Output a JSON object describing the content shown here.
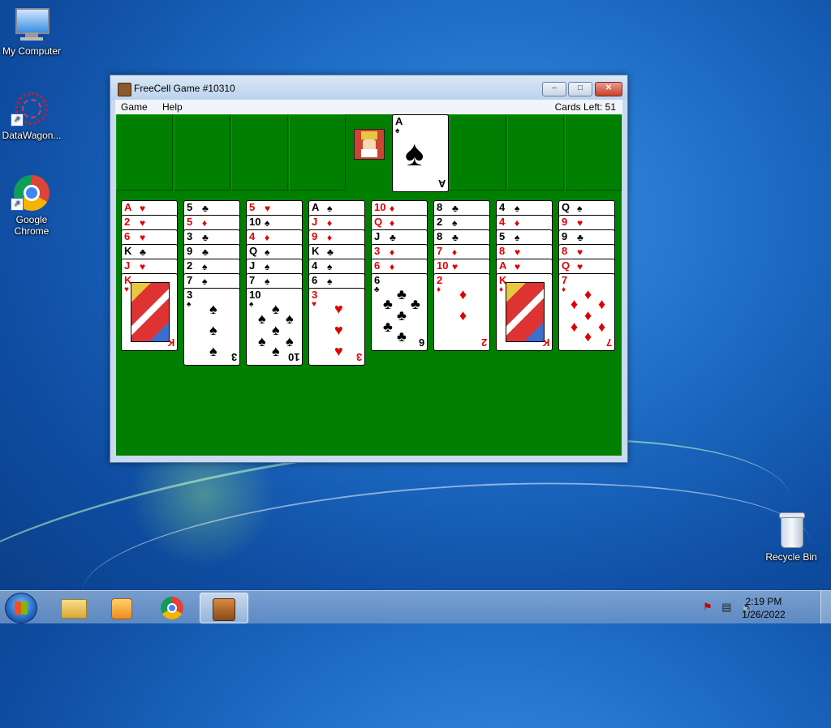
{
  "desktop": {
    "icons": [
      {
        "label": "My Computer"
      },
      {
        "label": "DataWagon..."
      },
      {
        "label": "Google Chrome"
      },
      {
        "label": "Recycle Bin"
      }
    ]
  },
  "window": {
    "title": "FreeCell Game #10310",
    "minimize": "–",
    "maximize": "□",
    "close": "✕",
    "menu": {
      "game": "Game",
      "help": "Help"
    },
    "cards_left": "Cards Left: 51"
  },
  "foundation": {
    "rank": "A",
    "suit": "♠"
  },
  "columns": [
    [
      "A",
      "2",
      "6",
      "K",
      "J",
      "K"
    ],
    [
      "5",
      "5",
      "3",
      "9",
      "2",
      "7",
      "3"
    ],
    [
      "5",
      "10",
      "4",
      "Q",
      "J",
      "7",
      "10"
    ],
    [
      "A",
      "J",
      "9",
      "K",
      "4",
      "6",
      "3"
    ],
    [
      "10",
      "Q",
      "J",
      "3",
      "6",
      "6"
    ],
    [
      "8",
      "2",
      "8",
      "7",
      "10",
      "2"
    ],
    [
      "4",
      "4",
      "5",
      "8",
      "A",
      "K"
    ],
    [
      "Q",
      "9",
      "9",
      "8",
      "Q",
      "7"
    ]
  ],
  "suits": [
    [
      "♥",
      "♥",
      "♥",
      "♣",
      "♥",
      "♥"
    ],
    [
      "♣",
      "♦",
      "♣",
      "♣",
      "♠",
      "♠",
      "♠"
    ],
    [
      "♥",
      "♠",
      "♦",
      "♠",
      "♠",
      "♠",
      "♠"
    ],
    [
      "♠",
      "♦",
      "♦",
      "♣",
      "♠",
      "♠",
      "♥"
    ],
    [
      "♦",
      "♦",
      "♣",
      "♦",
      "♦",
      "♣"
    ],
    [
      "♣",
      "♠",
      "♣",
      "♦",
      "♥",
      "♦"
    ],
    [
      "♠",
      "♦",
      "♠",
      "♥",
      "♥",
      "♦"
    ],
    [
      "♠",
      "♥",
      "♣",
      "♥",
      "♥",
      "♦"
    ]
  ],
  "colors": {
    "felt": "#007f00",
    "red": "#e10000",
    "black": "#000000"
  },
  "taskbar": {
    "time": "2:19 PM",
    "date": "1/26/2022",
    "buttons": [
      "start-orb",
      "file-explorer-icon",
      "media-player-icon",
      "chrome-icon",
      "freecell-icon"
    ]
  }
}
